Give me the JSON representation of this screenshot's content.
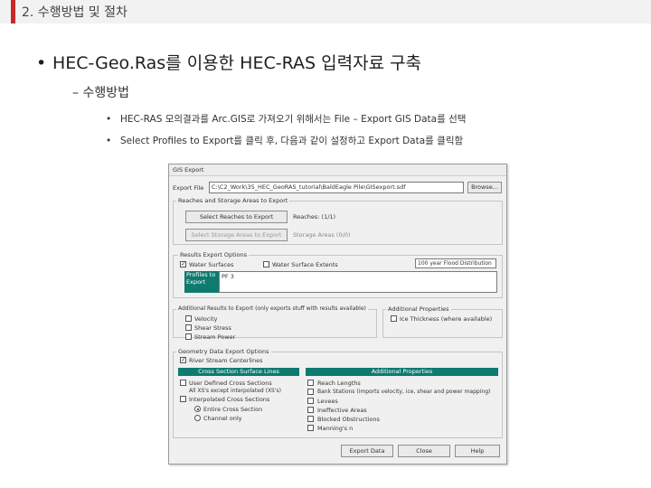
{
  "header": {
    "title": "2. 수행방법 및 절차"
  },
  "content": {
    "bullet1": "HEC-Geo.Ras를 이용한 HEC-RAS 입력자료 구축",
    "bullet2": "– 수행방법",
    "sub1": "HEC-RAS 모의결과를 Arc.GIS로 가져오기 위해서는 File – Export GIS Data를 선택",
    "sub2": "Select Profiles to Export를 클릭 후, 다음과 같이 설정하고 Export Data를 클릭함",
    "bullet_glyph": "•"
  },
  "dialog": {
    "title": "GIS Export",
    "export_file_label": "Export File",
    "export_file_value": "C:\\C2_Work\\35_HEC_GeoRAS_tutorial\\BaldEagle Pile\\GISexport.sdf",
    "browse_label": "Browse...",
    "reaches_group": "Reaches and Storage Areas to Export",
    "select_reaches_btn": "Select Reaches to Export",
    "reaches_status": "Reaches: (1/1)",
    "select_storage_btn": "Select Storage Areas to Export",
    "storage_status": "Storage Areas (0/0)",
    "results_group": "Results Export Options",
    "water_surfaces": "Water Surfaces",
    "water_surface_extents": "Water Surface Extents",
    "profile_selected": "100 year Flood Distribution",
    "profiles_to_export": "Profiles to Export",
    "profile_name": "PF 3",
    "add_results_group": "Additional Results to Export (only exports stuff with results available)",
    "velocity": "Velocity",
    "shear_stress": "Shear Stress",
    "stream_power": "Stream Power",
    "add_props_group": "Additional Properties",
    "ice_thickness": "Ice Thickness (where available)",
    "geometry_group": "Geometry Data Export Options",
    "river_centerlines": "River Stream Centerlines",
    "cross_section_header": "Cross Section Surface Lines",
    "additional_props_header": "Additional Properties",
    "user_defined_xs": "User Defined Cross Sections",
    "all_xs_note": "All XS's except interpolated (XS's)",
    "interpolated_xs": "Interpolated Cross Sections",
    "entire_xs": "Entire Cross Section",
    "channel_only": "Channel only",
    "reach_lengths": "Reach Lengths",
    "bank_stations": "Bank Stations (imports velocity, ice, shear and power mapping)",
    "levees": "Levees",
    "ineffective_areas": "Ineffective Areas",
    "blocked_obstructions": "Blocked Obstructions",
    "mannings_n": "Manning's n",
    "export_data_btn": "Export Data",
    "close_btn": "Close",
    "help_btn": "Help",
    "check_mark": "✓"
  },
  "colors": {
    "accent": "#c62828",
    "teal": "#0e7a70"
  }
}
